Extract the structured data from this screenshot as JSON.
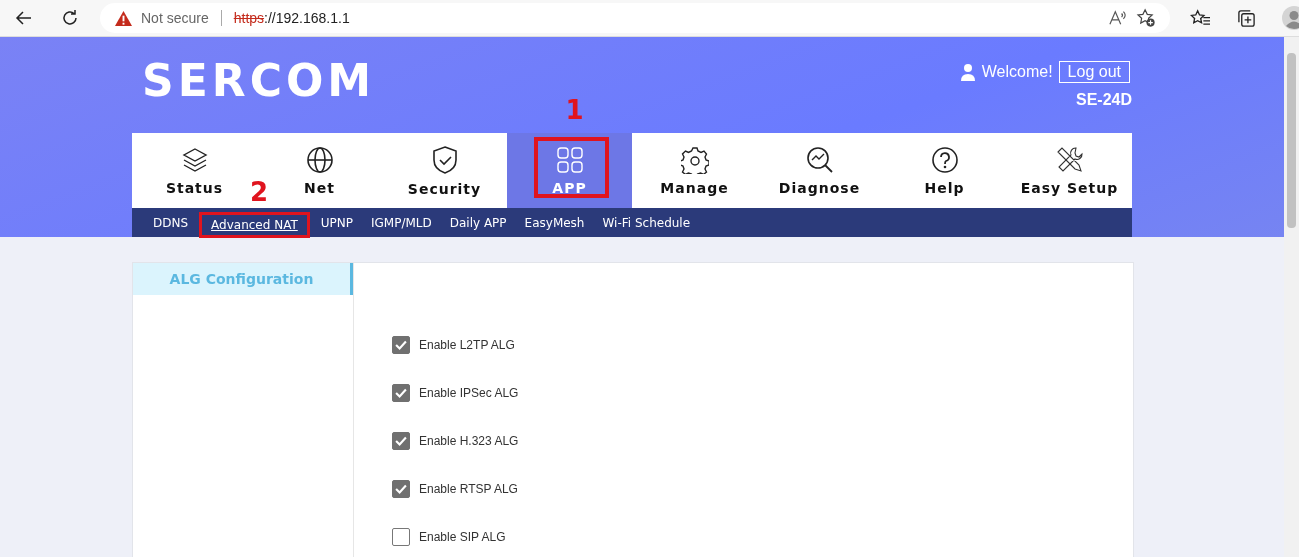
{
  "browser": {
    "security": "Not secure",
    "url_scheme": "https",
    "url_rest": "://192.168.1.1"
  },
  "header": {
    "logo": "SERCOM",
    "welcome": "Welcome!",
    "logout": "Log out",
    "model": "SE-24D"
  },
  "tabs": [
    {
      "label": "Status",
      "selected": false
    },
    {
      "label": "Net",
      "selected": false
    },
    {
      "label": "Security",
      "selected": false
    },
    {
      "label": "APP",
      "selected": true,
      "callout": "1"
    },
    {
      "label": "Manage",
      "selected": false
    },
    {
      "label": "Diagnose",
      "selected": false
    },
    {
      "label": "Help",
      "selected": false
    },
    {
      "label": "Easy Setup",
      "selected": false
    }
  ],
  "subtabs": [
    {
      "label": "DDNS",
      "selected": false
    },
    {
      "label": "Advanced NAT",
      "selected": true,
      "callout": "2"
    },
    {
      "label": "UPNP",
      "selected": false
    },
    {
      "label": "IGMP/MLD",
      "selected": false
    },
    {
      "label": "Daily APP",
      "selected": false
    },
    {
      "label": "EasyMesh",
      "selected": false
    },
    {
      "label": "Wi-Fi Schedule",
      "selected": false
    }
  ],
  "sidebar": {
    "items": [
      {
        "label": "ALG Configuration",
        "selected": true
      }
    ]
  },
  "options": [
    {
      "label": "Enable L2TP ALG",
      "checked": true
    },
    {
      "label": "Enable IPSec ALG",
      "checked": true
    },
    {
      "label": "Enable H.323 ALG",
      "checked": true
    },
    {
      "label": "Enable RTSP ALG",
      "checked": true
    },
    {
      "label": "Enable SIP ALG",
      "checked": false
    }
  ]
}
